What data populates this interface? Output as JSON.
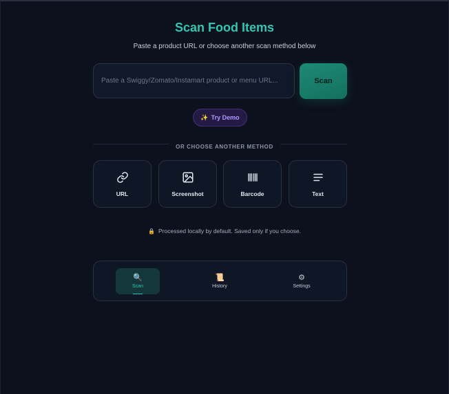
{
  "header": {
    "title": "Scan Food Items",
    "subtitle": "Paste a product URL or choose another scan method below"
  },
  "url_input": {
    "value": "",
    "placeholder": "Paste a Swiggy/Zomato/Instamart product or menu URL..."
  },
  "scan_button": {
    "label": "Scan"
  },
  "demo_button": {
    "icon": "sparkles-icon",
    "label": "Try Demo"
  },
  "divider": {
    "label": "OR CHOOSE ANOTHER METHOD"
  },
  "methods": [
    {
      "icon": "link-icon",
      "label": "URL"
    },
    {
      "icon": "image-icon",
      "label": "Screenshot"
    },
    {
      "icon": "barcode-icon",
      "label": "Barcode"
    },
    {
      "icon": "text-lines-icon",
      "label": "Text"
    }
  ],
  "privacy": {
    "icon": "lock-icon",
    "text": "Processed locally by default. Saved only if you choose."
  },
  "bottom_nav": {
    "items": [
      {
        "icon": "search-icon",
        "glyph": "🔍",
        "label": "Scan",
        "active": true
      },
      {
        "icon": "book-icon",
        "glyph": "📜",
        "label": "History",
        "active": false
      },
      {
        "icon": "gear-icon",
        "glyph": "⚙",
        "label": "Settings",
        "active": false
      }
    ]
  },
  "colors": {
    "background": "#0c111d",
    "accent": "#34c6b0",
    "scan_button": "#1d8a75",
    "demo_text": "#b397ff"
  }
}
